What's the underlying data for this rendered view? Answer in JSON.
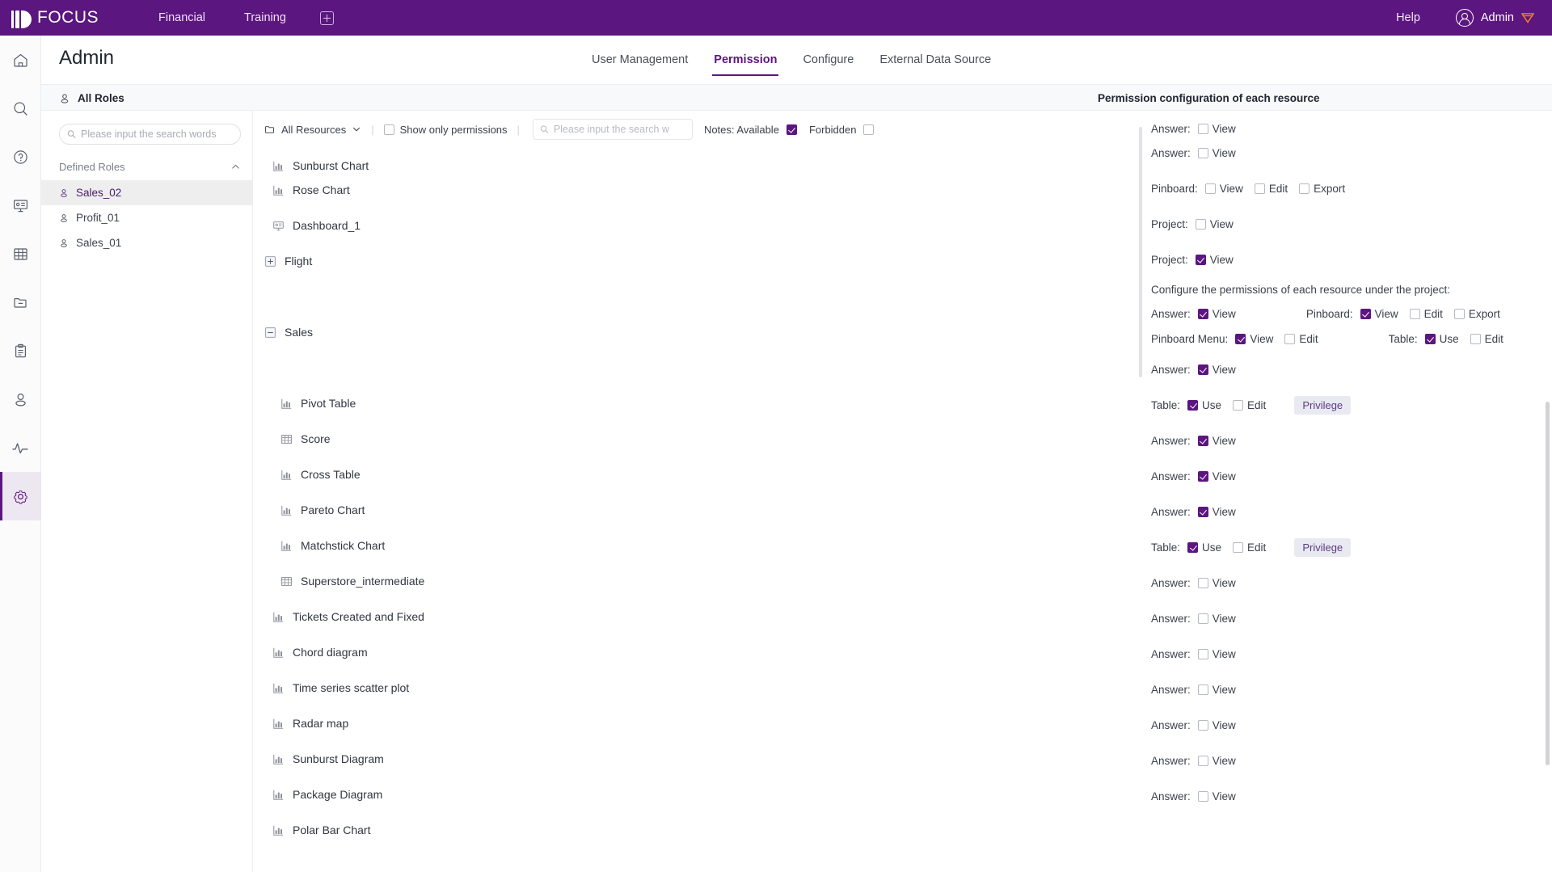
{
  "topbar": {
    "brand": "FOCUS",
    "nav": [
      {
        "label": "Financial"
      },
      {
        "label": "Training"
      }
    ],
    "add_tab_icon": "plus-square-icon",
    "help": "Help",
    "user": "Admin",
    "brand_color": "#5c1680",
    "badge_color": "#f08022"
  },
  "rail": {
    "items": [
      {
        "name": "home-icon"
      },
      {
        "name": "search-icon"
      },
      {
        "name": "help-circle-icon"
      },
      {
        "name": "dashboard-icon"
      },
      {
        "name": "table-icon"
      },
      {
        "name": "folder-minus-icon"
      },
      {
        "name": "clipboard-icon"
      },
      {
        "name": "user-icon"
      },
      {
        "name": "activity-icon"
      },
      {
        "name": "gear-icon"
      }
    ],
    "active_index": 9
  },
  "page": {
    "title": "Admin",
    "tabs": [
      {
        "label": "User Management",
        "active": false
      },
      {
        "label": "Permission",
        "active": true
      },
      {
        "label": "Configure",
        "active": false
      },
      {
        "label": "External Data Source",
        "active": false
      }
    ]
  },
  "band": {
    "left_title": "All Roles",
    "right_title": "Permission configuration of each resource"
  },
  "roles": {
    "search_placeholder": "Please input the search words",
    "search_value": "",
    "group_label": "Defined Roles",
    "items": [
      {
        "label": "Sales_02",
        "selected": true
      },
      {
        "label": "Profit_01",
        "selected": false
      },
      {
        "label": "Sales_01",
        "selected": false
      }
    ]
  },
  "res_toolbar": {
    "all_resources": "All Resources",
    "show_only_permissions": "Show only permissions",
    "show_only_permissions_checked": false,
    "search_placeholder": "Please input the search w",
    "search_value": "",
    "notes_label": "Notes: Available",
    "notes_checked": true,
    "forbidden_label": "Forbidden",
    "forbidden_checked": false
  },
  "tree": [
    {
      "label": "Sunburst Chart",
      "icon": "chart-bar-icon",
      "indent": 1,
      "type": "item",
      "clipped": true
    },
    {
      "label": "Rose Chart",
      "icon": "chart-bar-icon",
      "indent": 1,
      "type": "item"
    },
    {
      "label": "Dashboard_1",
      "icon": "dashboard-icon",
      "indent": 1,
      "type": "item"
    },
    {
      "label": "Flight",
      "icon": "plus-box-icon",
      "indent": 0,
      "type": "folder"
    },
    {
      "label": "",
      "icon": "",
      "indent": 0,
      "type": "spacer"
    },
    {
      "label": "Sales",
      "icon": "minus-box-icon",
      "indent": 0,
      "type": "folder"
    },
    {
      "label": "",
      "icon": "",
      "indent": 0,
      "type": "spacer"
    },
    {
      "label": "Pivot Table",
      "icon": "chart-bar-icon",
      "indent": 2,
      "type": "item"
    },
    {
      "label": "Score",
      "icon": "table-icon",
      "indent": 2,
      "type": "item"
    },
    {
      "label": "Cross Table",
      "icon": "chart-bar-icon",
      "indent": 2,
      "type": "item"
    },
    {
      "label": "Pareto Chart",
      "icon": "chart-bar-icon",
      "indent": 2,
      "type": "item"
    },
    {
      "label": "Matchstick Chart",
      "icon": "chart-bar-icon",
      "indent": 2,
      "type": "item"
    },
    {
      "label": "Superstore_intermediate",
      "icon": "table-icon",
      "indent": 2,
      "type": "item"
    },
    {
      "label": "Tickets Created and Fixed",
      "icon": "chart-bar-icon",
      "indent": 1,
      "type": "item"
    },
    {
      "label": "Chord diagram",
      "icon": "chart-bar-icon",
      "indent": 1,
      "type": "item"
    },
    {
      "label": "Time series scatter plot",
      "icon": "chart-bar-icon",
      "indent": 1,
      "type": "item"
    },
    {
      "label": "Radar map",
      "icon": "chart-bar-icon",
      "indent": 1,
      "type": "item"
    },
    {
      "label": "Sunburst Diagram",
      "icon": "chart-bar-icon",
      "indent": 1,
      "type": "item"
    },
    {
      "label": "Package Diagram",
      "icon": "chart-bar-icon",
      "indent": 1,
      "type": "item"
    },
    {
      "label": "Polar Bar Chart",
      "icon": "chart-bar-icon",
      "indent": 1,
      "type": "item"
    }
  ],
  "permissions": {
    "note_text": "Configure the permissions of each resource under the project:",
    "rows": [
      {
        "kind": "simple",
        "label": "Answer:",
        "boxes": [
          {
            "t": "View",
            "on": false
          }
        ],
        "clipped": true
      },
      {
        "kind": "simple",
        "label": "Answer:",
        "boxes": [
          {
            "t": "View",
            "on": false
          }
        ]
      },
      {
        "kind": "simple",
        "label": "Pinboard:",
        "boxes": [
          {
            "t": "View",
            "on": false
          },
          {
            "t": "Edit",
            "on": false
          },
          {
            "t": "Export",
            "on": false
          }
        ]
      },
      {
        "kind": "simple",
        "label": "Project:",
        "boxes": [
          {
            "t": "View",
            "on": false
          }
        ]
      },
      {
        "kind": "simple",
        "label": "Project:",
        "boxes": [
          {
            "t": "View",
            "on": true
          }
        ]
      },
      {
        "kind": "note"
      },
      {
        "kind": "dual",
        "left": {
          "label": "Answer:",
          "boxes": [
            {
              "t": "View",
              "on": true
            }
          ]
        },
        "right": {
          "label": "Pinboard:",
          "boxes": [
            {
              "t": "View",
              "on": true
            },
            {
              "t": "Edit",
              "on": false
            },
            {
              "t": "Export",
              "on": false
            }
          ]
        }
      },
      {
        "kind": "dual",
        "left": {
          "label": "Pinboard Menu:",
          "boxes": [
            {
              "t": "View",
              "on": true
            },
            {
              "t": "Edit",
              "on": false
            }
          ]
        },
        "right": {
          "label": "Table:",
          "boxes": [
            {
              "t": "Use",
              "on": true
            },
            {
              "t": "Edit",
              "on": false
            }
          ]
        }
      },
      {
        "kind": "simple",
        "label": "Answer:",
        "boxes": [
          {
            "t": "View",
            "on": true
          }
        ]
      },
      {
        "kind": "simple",
        "label": "Table:",
        "boxes": [
          {
            "t": "Use",
            "on": true
          },
          {
            "t": "Edit",
            "on": false
          }
        ],
        "privilege": "Privilege"
      },
      {
        "kind": "simple",
        "label": "Answer:",
        "boxes": [
          {
            "t": "View",
            "on": true
          }
        ]
      },
      {
        "kind": "simple",
        "label": "Answer:",
        "boxes": [
          {
            "t": "View",
            "on": true
          }
        ]
      },
      {
        "kind": "simple",
        "label": "Answer:",
        "boxes": [
          {
            "t": "View",
            "on": true
          }
        ]
      },
      {
        "kind": "simple",
        "label": "Table:",
        "boxes": [
          {
            "t": "Use",
            "on": true
          },
          {
            "t": "Edit",
            "on": false
          }
        ],
        "privilege": "Privilege"
      },
      {
        "kind": "simple",
        "label": "Answer:",
        "boxes": [
          {
            "t": "View",
            "on": false
          }
        ]
      },
      {
        "kind": "simple",
        "label": "Answer:",
        "boxes": [
          {
            "t": "View",
            "on": false
          }
        ]
      },
      {
        "kind": "simple",
        "label": "Answer:",
        "boxes": [
          {
            "t": "View",
            "on": false
          }
        ]
      },
      {
        "kind": "simple",
        "label": "Answer:",
        "boxes": [
          {
            "t": "View",
            "on": false
          }
        ]
      },
      {
        "kind": "simple",
        "label": "Answer:",
        "boxes": [
          {
            "t": "View",
            "on": false
          }
        ]
      },
      {
        "kind": "simple",
        "label": "Answer:",
        "boxes": [
          {
            "t": "View",
            "on": false
          }
        ]
      },
      {
        "kind": "simple",
        "label": "Answer:",
        "boxes": [
          {
            "t": "View",
            "on": false
          }
        ]
      }
    ]
  }
}
